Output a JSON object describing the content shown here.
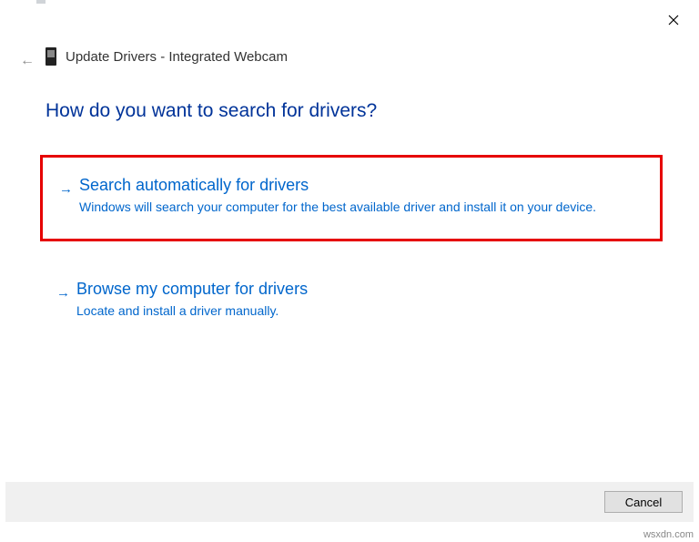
{
  "window": {
    "title": "Update Drivers - Integrated Webcam"
  },
  "heading": "How do you want to search for drivers?",
  "options": [
    {
      "title": "Search automatically for drivers",
      "desc": "Windows will search your computer for the best available driver and install it on your device."
    },
    {
      "title": "Browse my computer for drivers",
      "desc": "Locate and install a driver manually."
    }
  ],
  "buttons": {
    "cancel": "Cancel"
  },
  "watermark": "wsxdn.com"
}
